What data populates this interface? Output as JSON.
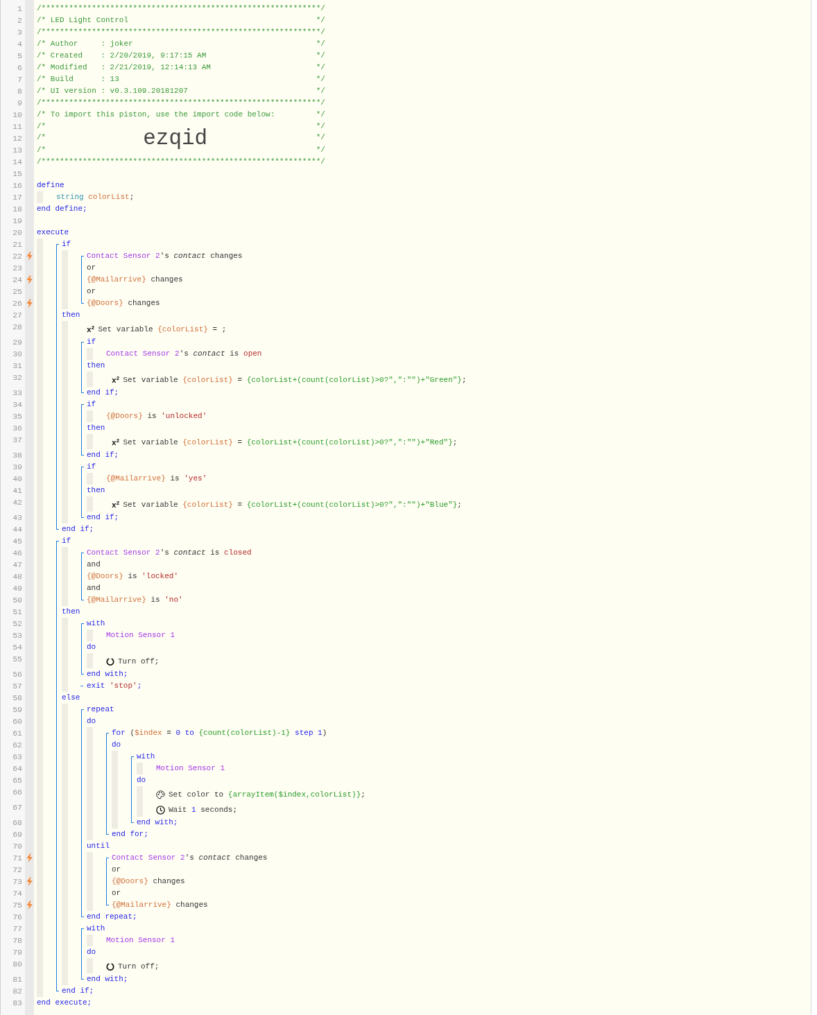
{
  "header": [
    {
      "n": "1",
      "tokens": [
        {
          "kind": "comment",
          "text": "/*************************************************************/"
        }
      ]
    },
    {
      "n": "2",
      "tokens": [
        {
          "kind": "comment",
          "text": "/* LED Light Control"
        },
        {
          "kind": "comment-end",
          "text": "*/"
        }
      ]
    },
    {
      "n": "3",
      "tokens": [
        {
          "kind": "comment",
          "text": "/*************************************************************/"
        }
      ]
    },
    {
      "n": "4",
      "tokens": [
        {
          "kind": "comment",
          "text": "/* Author     : joker"
        },
        {
          "kind": "comment-end",
          "text": "*/"
        }
      ]
    },
    {
      "n": "5",
      "tokens": [
        {
          "kind": "comment",
          "text": "/* Created    : 2/20/2019, 9:17:15 AM"
        },
        {
          "kind": "comment-end",
          "text": "*/"
        }
      ]
    },
    {
      "n": "6",
      "tokens": [
        {
          "kind": "comment",
          "text": "/* Modified   : 2/21/2019, 12:14:13 AM"
        },
        {
          "kind": "comment-end",
          "text": "*/"
        }
      ]
    },
    {
      "n": "7",
      "tokens": [
        {
          "kind": "comment",
          "text": "/* Build      : 13"
        },
        {
          "kind": "comment-end",
          "text": "*/"
        }
      ]
    },
    {
      "n": "8",
      "tokens": [
        {
          "kind": "comment",
          "text": "/* UI version : v0.3.109.20181207"
        },
        {
          "kind": "comment-end",
          "text": "*/"
        }
      ]
    },
    {
      "n": "9",
      "tokens": [
        {
          "kind": "comment",
          "text": "/*************************************************************/"
        }
      ]
    },
    {
      "n": "10",
      "tokens": [
        {
          "kind": "comment",
          "text": "/* To import this piston, use the import code below:"
        },
        {
          "kind": "comment-end",
          "text": "*/"
        }
      ]
    },
    {
      "n": "11",
      "tokens": [
        {
          "kind": "comment",
          "text": "/*"
        },
        {
          "kind": "comment-end",
          "text": "*/"
        }
      ]
    },
    {
      "n": "12",
      "tokens": [
        {
          "kind": "comment",
          "text": "/*"
        },
        {
          "kind": "import-code",
          "text": "ezqid"
        },
        {
          "kind": "comment-end",
          "text": "*/"
        }
      ]
    },
    {
      "n": "13",
      "tokens": [
        {
          "kind": "comment",
          "text": "/*"
        },
        {
          "kind": "comment-end",
          "text": "*/"
        }
      ]
    },
    {
      "n": "14",
      "tokens": [
        {
          "kind": "comment",
          "text": "/*************************************************************/"
        }
      ]
    },
    {
      "n": "15"
    }
  ],
  "code": [
    {
      "n": "16",
      "tokens": [
        {
          "kind": "keyword",
          "text": "define"
        }
      ],
      "children": [
        {
          "n": "17",
          "tokens": [
            {
              "kind": "type",
              "text": "string "
            },
            {
              "kind": "variable",
              "text": "colorList"
            },
            {
              "kind": "plain",
              "text": ";"
            }
          ]
        }
      ]
    },
    {
      "n": "18",
      "tokens": [
        {
          "kind": "keyword",
          "text": "end define;"
        }
      ]
    },
    {
      "n": "19"
    },
    {
      "n": "20",
      "tokens": [
        {
          "kind": "keyword",
          "text": "execute"
        }
      ],
      "children": [
        {
          "kind": "group",
          "items": [
            {
              "n": "21",
              "tokens": [
                {
                  "kind": "keyword",
                  "text": "if"
                }
              ],
              "children": [
                {
                  "kind": "group",
                  "items": [
                    {
                      "n": "22",
                      "trigger": true,
                      "tokens": [
                        {
                          "kind": "device",
                          "text": "Contact Sensor 2"
                        },
                        {
                          "kind": "plain",
                          "text": "'s "
                        },
                        {
                          "kind": "attribute",
                          "text": "contact"
                        },
                        {
                          "kind": "plain",
                          "text": " changes"
                        }
                      ]
                    },
                    {
                      "n": "23",
                      "tokens": [
                        {
                          "kind": "plain",
                          "text": "or"
                        }
                      ]
                    },
                    {
                      "n": "24",
                      "trigger": true,
                      "tokens": [
                        {
                          "kind": "variable",
                          "text": "{@Mailarrive}"
                        },
                        {
                          "kind": "plain",
                          "text": " changes"
                        }
                      ]
                    },
                    {
                      "n": "25",
                      "tokens": [
                        {
                          "kind": "plain",
                          "text": "or"
                        }
                      ]
                    },
                    {
                      "n": "26",
                      "trigger": true,
                      "tokens": [
                        {
                          "kind": "variable",
                          "text": "{@Doors}"
                        },
                        {
                          "kind": "plain",
                          "text": " changes"
                        }
                      ]
                    }
                  ]
                }
              ]
            },
            {
              "n": "27",
              "tokens": [
                {
                  "kind": "keyword",
                  "text": "then"
                }
              ],
              "children": [
                {
                  "n": "28",
                  "tokens": [
                    {
                      "kind": "marker",
                      "text": "x$^{2}$"
                    },
                    {
                      "kind": "plain",
                      "text": "Set variable "
                    },
                    {
                      "kind": "variable",
                      "text": "{colorList}"
                    },
                    {
                      "kind": "plain",
                      "text": " = ;"
                    }
                  ]
                },
                {
                  "kind": "group",
                  "items": [
                    {
                      "n": "29",
                      "tokens": [
                        {
                          "kind": "keyword",
                          "text": "if"
                        }
                      ],
                      "children": [
                        {
                          "n": "30",
                          "tokens": [
                            {
                              "kind": "device",
                              "text": "Contact Sensor 2"
                            },
                            {
                              "kind": "plain",
                              "text": "'s "
                            },
                            {
                              "kind": "attribute",
                              "text": "contact"
                            },
                            {
                              "kind": "plain",
                              "text": " is "
                            },
                            {
                              "kind": "value",
                              "text": "open"
                            }
                          ]
                        }
                      ]
                    },
                    {
                      "n": "31",
                      "tokens": [
                        {
                          "kind": "keyword",
                          "text": "then"
                        }
                      ],
                      "children": [
                        {
                          "n": "32",
                          "tokens": [
                            {
                              "kind": "marker",
                              "text": "x$^{2}$"
                            },
                            {
                              "kind": "plain",
                              "text": "Set variable "
                            },
                            {
                              "kind": "variable",
                              "text": "{colorList}"
                            },
                            {
                              "kind": "plain",
                              "text": " = "
                            },
                            {
                              "kind": "expression",
                              "text": "{colorList+(count(colorList)>0?\",\":\"\")+\"Green\"}"
                            },
                            {
                              "kind": "plain",
                              "text": ";"
                            }
                          ]
                        }
                      ]
                    },
                    {
                      "n": "33",
                      "tokens": [
                        {
                          "kind": "keyword",
                          "text": "end if;"
                        }
                      ]
                    }
                  ]
                },
                {
                  "kind": "group",
                  "items": [
                    {
                      "n": "34",
                      "tokens": [
                        {
                          "kind": "keyword",
                          "text": "if"
                        }
                      ],
                      "children": [
                        {
                          "n": "35",
                          "tokens": [
                            {
                              "kind": "variable",
                              "text": "{@Doors}"
                            },
                            {
                              "kind": "plain",
                              "text": " is "
                            },
                            {
                              "kind": "value",
                              "text": "'unlocked'"
                            }
                          ]
                        }
                      ]
                    },
                    {
                      "n": "36",
                      "tokens": [
                        {
                          "kind": "keyword",
                          "text": "then"
                        }
                      ],
                      "children": [
                        {
                          "n": "37",
                          "tokens": [
                            {
                              "kind": "marker",
                              "text": "x$^{2}$"
                            },
                            {
                              "kind": "plain",
                              "text": "Set variable "
                            },
                            {
                              "kind": "variable",
                              "text": "{colorList}"
                            },
                            {
                              "kind": "plain",
                              "text": " = "
                            },
                            {
                              "kind": "expression",
                              "text": "{colorList+(count(colorList)>0?\",\":\"\")+\"Red\"}"
                            },
                            {
                              "kind": "plain",
                              "text": ";"
                            }
                          ]
                        }
                      ]
                    },
                    {
                      "n": "38",
                      "tokens": [
                        {
                          "kind": "keyword",
                          "text": "end if;"
                        }
                      ]
                    }
                  ]
                },
                {
                  "kind": "group",
                  "items": [
                    {
                      "n": "39",
                      "tokens": [
                        {
                          "kind": "keyword",
                          "text": "if"
                        }
                      ],
                      "children": [
                        {
                          "n": "40",
                          "tokens": [
                            {
                              "kind": "variable",
                              "text": "{@Mailarrive}"
                            },
                            {
                              "kind": "plain",
                              "text": " is "
                            },
                            {
                              "kind": "value",
                              "text": "'yes'"
                            }
                          ]
                        }
                      ]
                    },
                    {
                      "n": "41",
                      "tokens": [
                        {
                          "kind": "keyword",
                          "text": "then"
                        }
                      ],
                      "children": [
                        {
                          "n": "42",
                          "tokens": [
                            {
                              "kind": "marker",
                              "text": "x$^{2}$"
                            },
                            {
                              "kind": "plain",
                              "text": "Set variable "
                            },
                            {
                              "kind": "variable",
                              "text": "{colorList}"
                            },
                            {
                              "kind": "plain",
                              "text": " = "
                            },
                            {
                              "kind": "expression",
                              "text": "{colorList+(count(colorList)>0?\",\":\"\")+\"Blue\"}"
                            },
                            {
                              "kind": "plain",
                              "text": ";"
                            }
                          ]
                        }
                      ]
                    },
                    {
                      "n": "43",
                      "tokens": [
                        {
                          "kind": "keyword",
                          "text": "end if;"
                        }
                      ]
                    }
                  ]
                }
              ]
            },
            {
              "n": "44",
              "tokens": [
                {
                  "kind": "keyword",
                  "text": "end if;"
                }
              ]
            }
          ]
        },
        {
          "kind": "group",
          "items": [
            {
              "n": "45",
              "tokens": [
                {
                  "kind": "keyword",
                  "text": "if"
                }
              ],
              "children": [
                {
                  "kind": "group",
                  "items": [
                    {
                      "n": "46",
                      "tokens": [
                        {
                          "kind": "device",
                          "text": "Contact Sensor 2"
                        },
                        {
                          "kind": "plain",
                          "text": "'s "
                        },
                        {
                          "kind": "attribute",
                          "text": "contact"
                        },
                        {
                          "kind": "plain",
                          "text": " is "
                        },
                        {
                          "kind": "value",
                          "text": "closed"
                        }
                      ]
                    },
                    {
                      "n": "47",
                      "tokens": [
                        {
                          "kind": "plain",
                          "text": "and"
                        }
                      ]
                    },
                    {
                      "n": "48",
                      "tokens": [
                        {
                          "kind": "variable",
                          "text": "{@Doors}"
                        },
                        {
                          "kind": "plain",
                          "text": " is "
                        },
                        {
                          "kind": "value",
                          "text": "'locked'"
                        }
                      ]
                    },
                    {
                      "n": "49",
                      "tokens": [
                        {
                          "kind": "plain",
                          "text": "and"
                        }
                      ]
                    },
                    {
                      "n": "50",
                      "tokens": [
                        {
                          "kind": "variable",
                          "text": "{@Mailarrive}"
                        },
                        {
                          "kind": "plain",
                          "text": " is "
                        },
                        {
                          "kind": "value",
                          "text": "'no'"
                        }
                      ]
                    }
                  ]
                }
              ]
            },
            {
              "n": "51",
              "tokens": [
                {
                  "kind": "keyword",
                  "text": "then"
                }
              ],
              "children": [
                {
                  "kind": "group",
                  "items": [
                    {
                      "n": "52",
                      "tokens": [
                        {
                          "kind": "keyword",
                          "text": "with"
                        }
                      ],
                      "children": [
                        {
                          "n": "53",
                          "tokens": [
                            {
                              "kind": "device",
                              "text": "Motion Sensor 1"
                            }
                          ]
                        }
                      ]
                    },
                    {
                      "n": "54",
                      "tokens": [
                        {
                          "kind": "keyword",
                          "text": "do"
                        }
                      ],
                      "children": [
                        {
                          "n": "55",
                          "kind": "power-action",
                          "tokens": [
                            {
                              "kind": "plain",
                              "text": "Turn off;"
                            }
                          ]
                        }
                      ]
                    },
                    {
                      "n": "56",
                      "tokens": [
                        {
                          "kind": "keyword",
                          "text": "end with;"
                        }
                      ]
                    }
                  ]
                },
                {
                  "kind": "group",
                  "items": [
                    {
                      "n": "57",
                      "tokens": [
                        {
                          "kind": "keyword",
                          "text": "exit "
                        },
                        {
                          "kind": "value",
                          "text": "'stop'"
                        },
                        {
                          "kind": "keyword",
                          "text": ";"
                        }
                      ]
                    }
                  ]
                }
              ]
            },
            {
              "n": "58",
              "tokens": [
                {
                  "kind": "keyword",
                  "text": "else"
                }
              ],
              "children": [
                {
                  "kind": "group",
                  "items": [
                    {
                      "n": "59",
                      "tokens": [
                        {
                          "kind": "keyword",
                          "text": "repeat"
                        }
                      ]
                    },
                    {
                      "n": "60",
                      "tokens": [
                        {
                          "kind": "keyword",
                          "text": "do"
                        }
                      ],
                      "children": [
                        {
                          "kind": "group",
                          "items": [
                            {
                              "n": "61",
                              "tokens": [
                                {
                                  "kind": "keyword",
                                  "text": "for"
                                },
                                {
                                  "kind": "plain",
                                  "text": " ("
                                },
                                {
                                  "kind": "variable",
                                  "text": "$index"
                                },
                                {
                                  "kind": "plain",
                                  "text": " = "
                                },
                                {
                                  "kind": "number",
                                  "text": "0"
                                },
                                {
                                  "kind": "keyword",
                                  "text": " to "
                                },
                                {
                                  "kind": "expression",
                                  "text": "{count(colorList)-1}"
                                },
                                {
                                  "kind": "keyword",
                                  "text": " step "
                                },
                                {
                                  "kind": "number",
                                  "text": "1"
                                },
                                {
                                  "kind": "plain",
                                  "text": ")"
                                }
                              ]
                            },
                            {
                              "n": "62",
                              "tokens": [
                                {
                                  "kind": "keyword",
                                  "text": "do"
                                }
                              ],
                              "children": [
                                {
                                  "kind": "group",
                                  "items": [
                                    {
                                      "n": "63",
                                      "tokens": [
                                        {
                                          "kind": "keyword",
                                          "text": "with"
                                        }
                                      ],
                                      "children": [
                                        {
                                          "n": "64",
                                          "tokens": [
                                            {
                                              "kind": "device",
                                              "text": "Motion Sensor 1"
                                            }
                                          ]
                                        }
                                      ]
                                    },
                                    {
                                      "n": "65",
                                      "tokens": [
                                        {
                                          "kind": "keyword",
                                          "text": "do"
                                        }
                                      ],
                                      "children": [
                                        {
                                          "n": "66",
                                          "kind": "palette-action",
                                          "tokens": [
                                            {
                                              "kind": "plain",
                                              "text": "Set color to "
                                            },
                                            {
                                              "kind": "expression",
                                              "text": "{arrayItem($index,colorList)}"
                                            },
                                            {
                                              "kind": "plain",
                                              "text": ";"
                                            }
                                          ]
                                        },
                                        {
                                          "n": "67",
                                          "kind": "clock-action",
                                          "tokens": [
                                            {
                                              "kind": "plain",
                                              "text": "Wait "
                                            },
                                            {
                                              "kind": "number",
                                              "text": "1"
                                            },
                                            {
                                              "kind": "plain",
                                              "text": " seconds;"
                                            }
                                          ]
                                        }
                                      ]
                                    },
                                    {
                                      "n": "68",
                                      "tokens": [
                                        {
                                          "kind": "keyword",
                                          "text": "end with;"
                                        }
                                      ]
                                    }
                                  ]
                                }
                              ]
                            },
                            {
                              "n": "69",
                              "tokens": [
                                {
                                  "kind": "keyword",
                                  "text": "end for;"
                                }
                              ]
                            }
                          ]
                        }
                      ]
                    },
                    {
                      "n": "70",
                      "tokens": [
                        {
                          "kind": "keyword",
                          "text": "until"
                        }
                      ],
                      "children": [
                        {
                          "kind": "group",
                          "items": [
                            {
                              "n": "71",
                              "trigger": true,
                              "tokens": [
                                {
                                  "kind": "device",
                                  "text": "Contact Sensor 2"
                                },
                                {
                                  "kind": "plain",
                                  "text": "'s "
                                },
                                {
                                  "kind": "attribute",
                                  "text": "contact"
                                },
                                {
                                  "kind": "plain",
                                  "text": " changes"
                                }
                              ]
                            },
                            {
                              "n": "72",
                              "tokens": [
                                {
                                  "kind": "plain",
                                  "text": "or"
                                }
                              ]
                            },
                            {
                              "n": "73",
                              "trigger": true,
                              "tokens": [
                                {
                                  "kind": "variable",
                                  "text": "{@Doors}"
                                },
                                {
                                  "kind": "plain",
                                  "text": " changes"
                                }
                              ]
                            },
                            {
                              "n": "74",
                              "tokens": [
                                {
                                  "kind": "plain",
                                  "text": "or"
                                }
                              ]
                            },
                            {
                              "n": "75",
                              "trigger": true,
                              "tokens": [
                                {
                                  "kind": "variable",
                                  "text": "{@Mailarrive}"
                                },
                                {
                                  "kind": "plain",
                                  "text": " changes"
                                }
                              ]
                            }
                          ]
                        }
                      ]
                    },
                    {
                      "n": "76",
                      "tokens": [
                        {
                          "kind": "keyword",
                          "text": "end repeat;"
                        }
                      ]
                    }
                  ]
                },
                {
                  "kind": "group",
                  "items": [
                    {
                      "n": "77",
                      "tokens": [
                        {
                          "kind": "keyword",
                          "text": "with"
                        }
                      ],
                      "children": [
                        {
                          "n": "78",
                          "tokens": [
                            {
                              "kind": "device",
                              "text": "Motion Sensor 1"
                            }
                          ]
                        }
                      ]
                    },
                    {
                      "n": "79",
                      "tokens": [
                        {
                          "kind": "keyword",
                          "text": "do"
                        }
                      ],
                      "children": [
                        {
                          "n": "80",
                          "kind": "power-action",
                          "tokens": [
                            {
                              "kind": "plain",
                              "text": "Turn off;"
                            }
                          ]
                        }
                      ]
                    },
                    {
                      "n": "81",
                      "tokens": [
                        {
                          "kind": "keyword",
                          "text": "end with;"
                        }
                      ]
                    }
                  ]
                }
              ]
            },
            {
              "n": "82",
              "tokens": [
                {
                  "kind": "keyword",
                  "text": "end if;"
                }
              ]
            }
          ]
        }
      ]
    },
    {
      "n": "83",
      "tokens": [
        {
          "kind": "keyword",
          "text": "end execute;"
        }
      ]
    }
  ]
}
